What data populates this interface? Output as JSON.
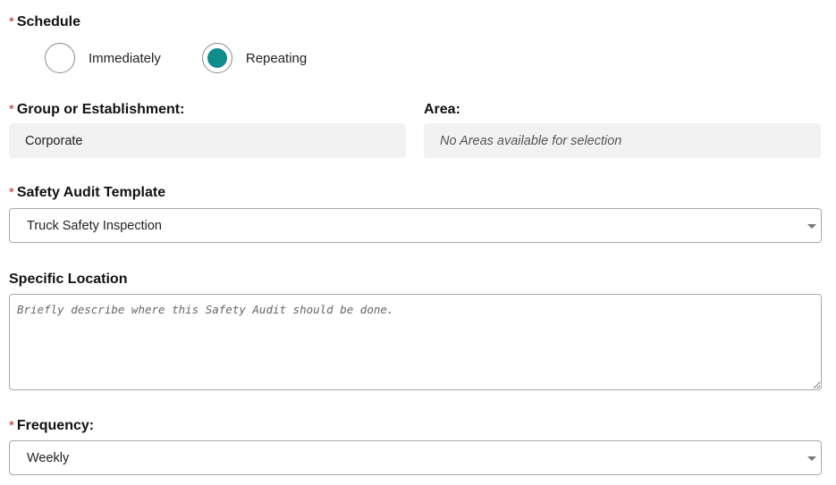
{
  "schedule": {
    "required_mark": "*",
    "label": "Schedule",
    "options": [
      {
        "label": "Immediately",
        "selected": false
      },
      {
        "label": "Repeating",
        "selected": true
      }
    ],
    "accent_color": "#0f8c8c"
  },
  "group": {
    "required_mark": "*",
    "label": "Group or Establishment:",
    "value": "Corporate"
  },
  "area": {
    "label": "Area:",
    "value": "No Areas available for selection"
  },
  "template": {
    "required_mark": "*",
    "label": "Safety Audit Template",
    "value": "Truck Safety Inspection"
  },
  "location": {
    "label": "Specific Location",
    "placeholder": "Briefly describe where this Safety Audit should be done."
  },
  "frequency": {
    "required_mark": "*",
    "label": "Frequency:",
    "value": "Weekly"
  }
}
